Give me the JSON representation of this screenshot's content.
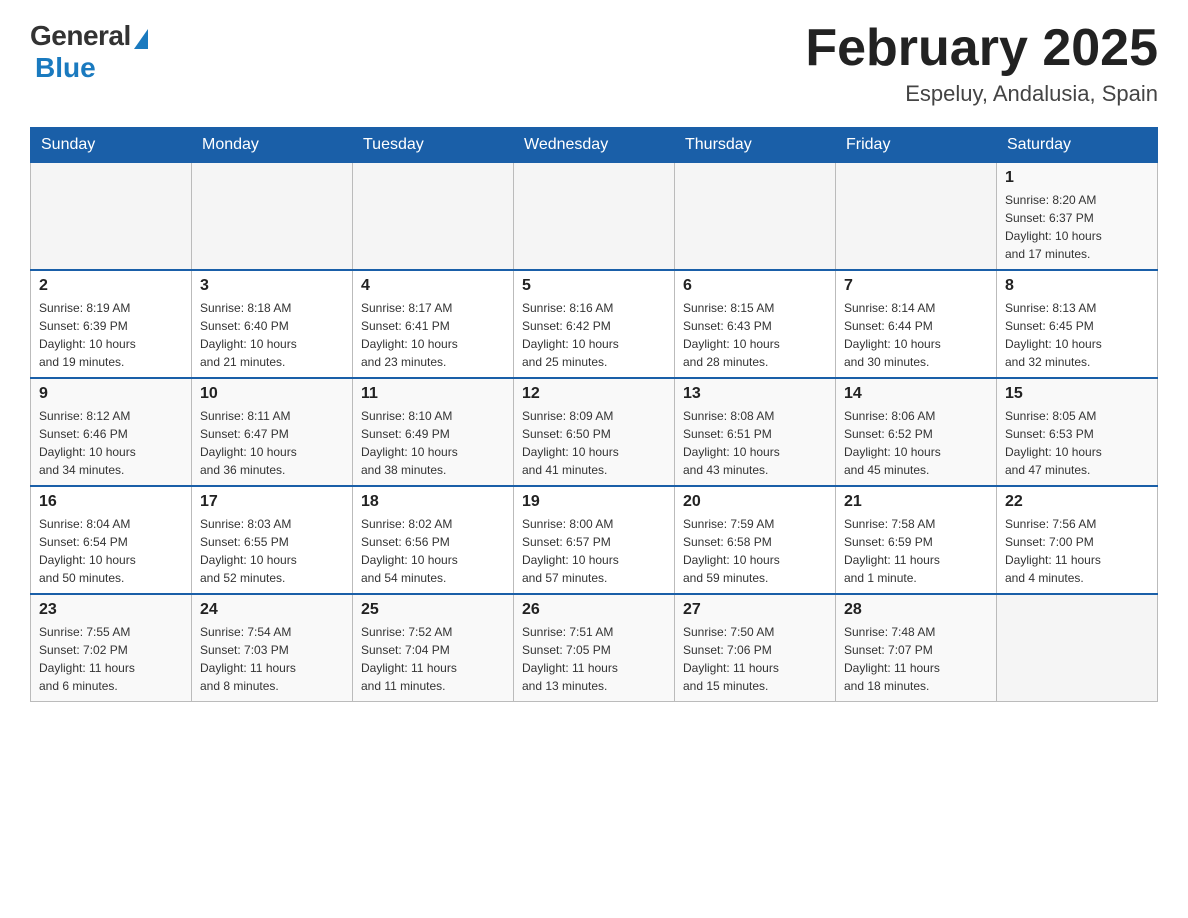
{
  "header": {
    "logo_general": "General",
    "logo_blue": "Blue",
    "month_title": "February 2025",
    "location": "Espeluy, Andalusia, Spain"
  },
  "weekdays": [
    "Sunday",
    "Monday",
    "Tuesday",
    "Wednesday",
    "Thursday",
    "Friday",
    "Saturday"
  ],
  "weeks": [
    [
      {
        "day": "",
        "info": ""
      },
      {
        "day": "",
        "info": ""
      },
      {
        "day": "",
        "info": ""
      },
      {
        "day": "",
        "info": ""
      },
      {
        "day": "",
        "info": ""
      },
      {
        "day": "",
        "info": ""
      },
      {
        "day": "1",
        "info": "Sunrise: 8:20 AM\nSunset: 6:37 PM\nDaylight: 10 hours\nand 17 minutes."
      }
    ],
    [
      {
        "day": "2",
        "info": "Sunrise: 8:19 AM\nSunset: 6:39 PM\nDaylight: 10 hours\nand 19 minutes."
      },
      {
        "day": "3",
        "info": "Sunrise: 8:18 AM\nSunset: 6:40 PM\nDaylight: 10 hours\nand 21 minutes."
      },
      {
        "day": "4",
        "info": "Sunrise: 8:17 AM\nSunset: 6:41 PM\nDaylight: 10 hours\nand 23 minutes."
      },
      {
        "day": "5",
        "info": "Sunrise: 8:16 AM\nSunset: 6:42 PM\nDaylight: 10 hours\nand 25 minutes."
      },
      {
        "day": "6",
        "info": "Sunrise: 8:15 AM\nSunset: 6:43 PM\nDaylight: 10 hours\nand 28 minutes."
      },
      {
        "day": "7",
        "info": "Sunrise: 8:14 AM\nSunset: 6:44 PM\nDaylight: 10 hours\nand 30 minutes."
      },
      {
        "day": "8",
        "info": "Sunrise: 8:13 AM\nSunset: 6:45 PM\nDaylight: 10 hours\nand 32 minutes."
      }
    ],
    [
      {
        "day": "9",
        "info": "Sunrise: 8:12 AM\nSunset: 6:46 PM\nDaylight: 10 hours\nand 34 minutes."
      },
      {
        "day": "10",
        "info": "Sunrise: 8:11 AM\nSunset: 6:47 PM\nDaylight: 10 hours\nand 36 minutes."
      },
      {
        "day": "11",
        "info": "Sunrise: 8:10 AM\nSunset: 6:49 PM\nDaylight: 10 hours\nand 38 minutes."
      },
      {
        "day": "12",
        "info": "Sunrise: 8:09 AM\nSunset: 6:50 PM\nDaylight: 10 hours\nand 41 minutes."
      },
      {
        "day": "13",
        "info": "Sunrise: 8:08 AM\nSunset: 6:51 PM\nDaylight: 10 hours\nand 43 minutes."
      },
      {
        "day": "14",
        "info": "Sunrise: 8:06 AM\nSunset: 6:52 PM\nDaylight: 10 hours\nand 45 minutes."
      },
      {
        "day": "15",
        "info": "Sunrise: 8:05 AM\nSunset: 6:53 PM\nDaylight: 10 hours\nand 47 minutes."
      }
    ],
    [
      {
        "day": "16",
        "info": "Sunrise: 8:04 AM\nSunset: 6:54 PM\nDaylight: 10 hours\nand 50 minutes."
      },
      {
        "day": "17",
        "info": "Sunrise: 8:03 AM\nSunset: 6:55 PM\nDaylight: 10 hours\nand 52 minutes."
      },
      {
        "day": "18",
        "info": "Sunrise: 8:02 AM\nSunset: 6:56 PM\nDaylight: 10 hours\nand 54 minutes."
      },
      {
        "day": "19",
        "info": "Sunrise: 8:00 AM\nSunset: 6:57 PM\nDaylight: 10 hours\nand 57 minutes."
      },
      {
        "day": "20",
        "info": "Sunrise: 7:59 AM\nSunset: 6:58 PM\nDaylight: 10 hours\nand 59 minutes."
      },
      {
        "day": "21",
        "info": "Sunrise: 7:58 AM\nSunset: 6:59 PM\nDaylight: 11 hours\nand 1 minute."
      },
      {
        "day": "22",
        "info": "Sunrise: 7:56 AM\nSunset: 7:00 PM\nDaylight: 11 hours\nand 4 minutes."
      }
    ],
    [
      {
        "day": "23",
        "info": "Sunrise: 7:55 AM\nSunset: 7:02 PM\nDaylight: 11 hours\nand 6 minutes."
      },
      {
        "day": "24",
        "info": "Sunrise: 7:54 AM\nSunset: 7:03 PM\nDaylight: 11 hours\nand 8 minutes."
      },
      {
        "day": "25",
        "info": "Sunrise: 7:52 AM\nSunset: 7:04 PM\nDaylight: 11 hours\nand 11 minutes."
      },
      {
        "day": "26",
        "info": "Sunrise: 7:51 AM\nSunset: 7:05 PM\nDaylight: 11 hours\nand 13 minutes."
      },
      {
        "day": "27",
        "info": "Sunrise: 7:50 AM\nSunset: 7:06 PM\nDaylight: 11 hours\nand 15 minutes."
      },
      {
        "day": "28",
        "info": "Sunrise: 7:48 AM\nSunset: 7:07 PM\nDaylight: 11 hours\nand 18 minutes."
      },
      {
        "day": "",
        "info": ""
      }
    ]
  ]
}
